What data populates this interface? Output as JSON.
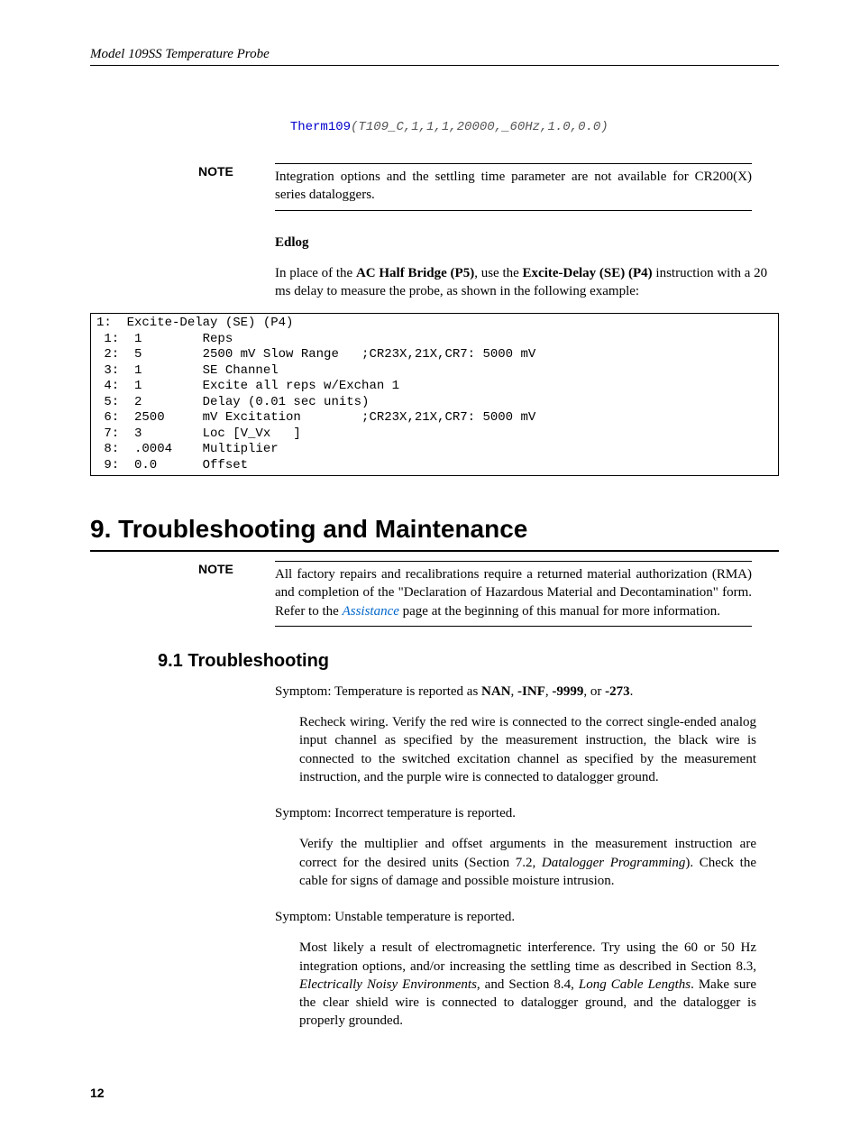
{
  "header": {
    "title": "Model 109SS Temperature Probe"
  },
  "code_inline": {
    "fn": "Therm109",
    "args": "(T109_C,1,1,1,20000,_60Hz,1.0,0.0)"
  },
  "note1": {
    "label": "NOTE",
    "text": "Integration options and the settling time parameter are not available for CR200(X) series dataloggers."
  },
  "edlog": {
    "heading": "Edlog",
    "intro_pre": "In place of the ",
    "intro_b1": "AC Half Bridge (P5)",
    "intro_mid": ", use the ",
    "intro_b2": "Excite-Delay (SE) (P4)",
    "intro_post": " instruction with a 20 ms delay to measure the probe, as shown in the following example:"
  },
  "codebox": "1:  Excite-Delay (SE) (P4)\n 1:  1        Reps\n 2:  5        2500 mV Slow Range   ;CR23X,21X,CR7: 5000 mV\n 3:  1        SE Channel\n 4:  1        Excite all reps w/Exchan 1\n 5:  2        Delay (0.01 sec units)\n 6:  2500     mV Excitation        ;CR23X,21X,CR7: 5000 mV\n 7:  3        Loc [V_Vx   ]\n 8:  .0004    Multiplier\n 9:  0.0      Offset",
  "section9": {
    "title": "9.    Troubleshooting and Maintenance",
    "note": {
      "label": "NOTE",
      "pre": "All factory repairs and recalibrations require a returned material authorization (RMA) and completion of the \"Declaration of Hazardous Material and Decontamination\" form.  Refer to the ",
      "link": "Assistance",
      "post": " page at the beginning of this manual for more information."
    }
  },
  "section91": {
    "title": "9.1   Troubleshooting",
    "s1": {
      "label": "Symptom:  Temperature is reported as ",
      "b1": "NAN",
      "c1": ", ",
      "b2": "-INF",
      "c2": ", ",
      "b3": "-9999",
      "c3": ", or ",
      "b4": "-273",
      "c4": ".",
      "remedy": "Recheck wiring.  Verify the red wire is connected to the correct single-ended analog input channel as specified by the measurement instruction, the black wire is connected to the switched excitation channel as specified by the measurement instruction, and the purple wire is connected to datalogger ground."
    },
    "s2": {
      "label": "Symptom:  Incorrect temperature is reported.",
      "remedy_pre": "Verify the multiplier and offset arguments in the measurement instruction are correct for the desired units (Section 7.2, ",
      "remedy_i": "Datalogger Programming",
      "remedy_post": ").  Check the cable for signs of damage and possible moisture intrusion."
    },
    "s3": {
      "label": "Symptom:  Unstable temperature is reported.",
      "remedy_pre": "Most likely a result of electromagnetic interference.  Try using the 60 or 50 Hz integration options, and/or increasing the settling time as described in Section 8.3, ",
      "remedy_i1": "Electrically Noisy Environments",
      "remedy_mid": ", and Section 8.4, ",
      "remedy_i2": "Long Cable Lengths",
      "remedy_post": ".  Make sure the clear shield wire is connected to datalogger ground, and the datalogger is properly grounded."
    }
  },
  "page_number": "12"
}
